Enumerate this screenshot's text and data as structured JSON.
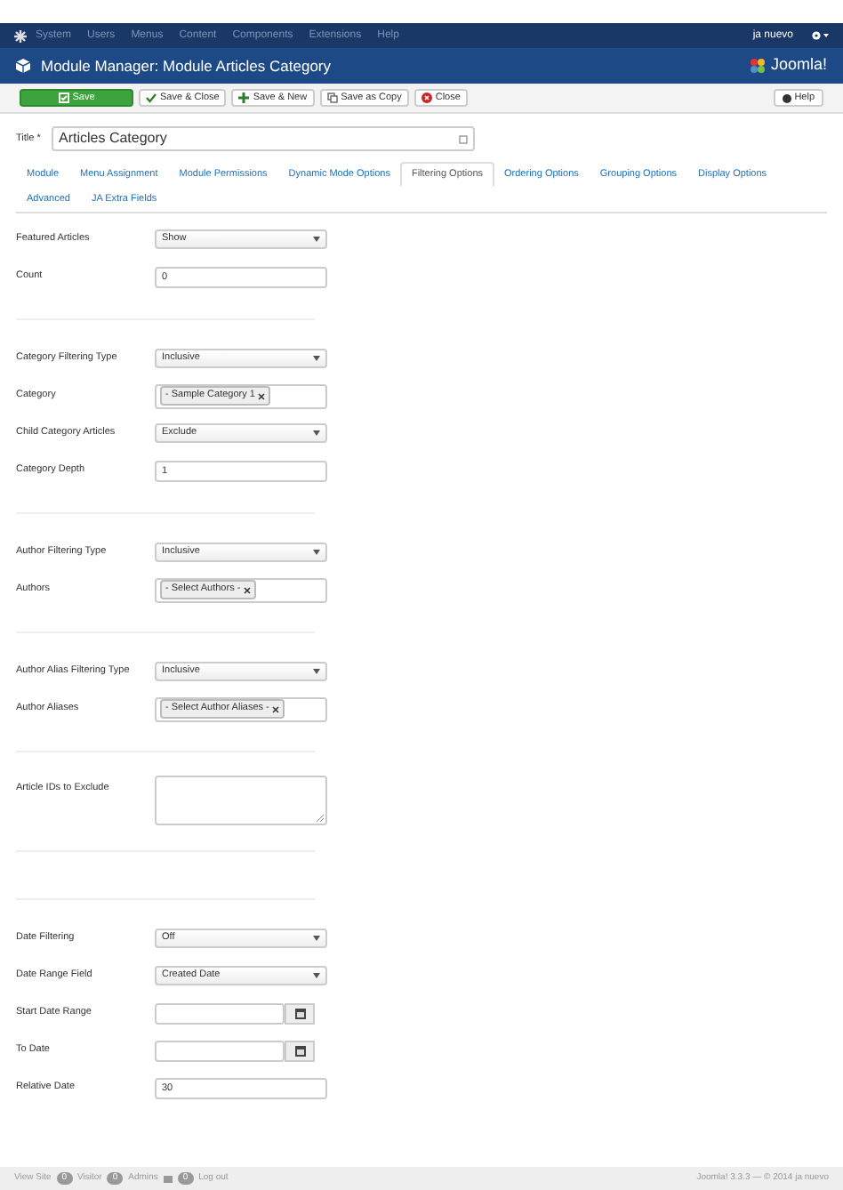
{
  "top_menu": {
    "items": [
      "System",
      "Users",
      "Menus",
      "Content",
      "Components",
      "Extensions",
      "Help"
    ],
    "user": "ja nuevo"
  },
  "header": {
    "title": "Module Manager: Module Articles Category",
    "logo_text": "Joomla!"
  },
  "toolbar": {
    "buttons": [
      {
        "label": "Save",
        "kind": "primary"
      },
      {
        "label": "Save & Close",
        "kind": "check"
      },
      {
        "label": "Save & New",
        "kind": "plus"
      },
      {
        "label": "Save as Copy",
        "kind": "copy"
      },
      {
        "label": "Close",
        "kind": "close"
      }
    ],
    "help": "Help"
  },
  "title_field": {
    "label": "Title *",
    "value": "Articles Category"
  },
  "tabs": [
    {
      "label": "Module",
      "selected": false
    },
    {
      "label": "Menu Assignment",
      "selected": false
    },
    {
      "label": "Module Permissions",
      "selected": false
    },
    {
      "label": "Dynamic Mode Options",
      "selected": false
    },
    {
      "label": "Filtering Options",
      "selected": true
    },
    {
      "label": "Ordering Options",
      "selected": false
    },
    {
      "label": "Grouping Options",
      "selected": false
    },
    {
      "label": "Display Options",
      "selected": false
    },
    {
      "label": "Advanced",
      "selected": false
    },
    {
      "label": "JA Extra Fields",
      "selected": false
    }
  ],
  "sections": [
    {
      "fields": [
        {
          "label": "Featured Articles",
          "kind": "select",
          "value": "Show"
        },
        {
          "label": "Count",
          "kind": "text",
          "value": "0"
        }
      ]
    },
    {
      "fields": [
        {
          "label": "Category Filtering Type",
          "kind": "select",
          "value": "Inclusive"
        },
        {
          "label": "Category",
          "kind": "tags",
          "value": "- Sample Category 1"
        },
        {
          "label": "Child Category Articles",
          "kind": "select",
          "value": "Exclude"
        },
        {
          "label": "Category Depth",
          "kind": "text",
          "value": "1"
        }
      ]
    },
    {
      "fields": [
        {
          "label": "Author Filtering Type",
          "kind": "select",
          "value": "Inclusive"
        },
        {
          "label": "Authors",
          "kind": "tags",
          "value": "- Select Authors -"
        }
      ]
    },
    {
      "fields": [
        {
          "label": "Author Alias Filtering Type",
          "kind": "select",
          "value": "Inclusive"
        },
        {
          "label": "Author Aliases",
          "kind": "tags",
          "value": "- Select Author Aliases -"
        }
      ]
    },
    {
      "fields": [
        {
          "label": "Article IDs to Exclude",
          "kind": "textarea"
        }
      ]
    },
    {
      "fields": [
        {
          "label": "Date Filtering",
          "kind": "select",
          "value": "Off"
        },
        {
          "label": "Date Range Field",
          "kind": "select",
          "value": "Created Date"
        },
        {
          "label": "Start Date Range",
          "kind": "date"
        },
        {
          "label": "To Date",
          "kind": "date"
        },
        {
          "label": "Relative Date",
          "kind": "text",
          "value": "30"
        }
      ]
    }
  ],
  "footer": {
    "view_site": "View Site",
    "visitors": "0",
    "visitors_label": "Visitor",
    "admins": "0",
    "admins_label": "Admins",
    "messages": "0",
    "logout": "Log out",
    "version": "Joomla! 3.3.3 — © 2014 ja nuevo"
  }
}
